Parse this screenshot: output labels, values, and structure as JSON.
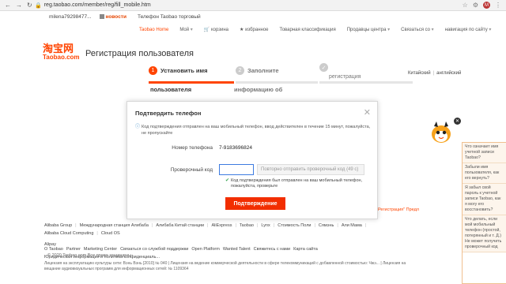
{
  "browser": {
    "url": "reg.taobao.com/member/reg/fill_mobile.htm",
    "profile_initial": "M"
  },
  "topbar": {
    "user": "milena79298477...",
    "news_label": "новости",
    "phone_line": "Телефон Taobao торговый"
  },
  "sitenav": {
    "items": [
      "Taobao Home",
      "Мой",
      "корзина",
      "избранное",
      "Товарная классификация",
      "Продавцы центра",
      "Связаться со",
      "навигация по сайту"
    ]
  },
  "header": {
    "logo_cn": "淘宝网",
    "logo_en": "Taobao.com",
    "title": "Регистрация пользователя"
  },
  "steps": {
    "step1_num": "1",
    "step1_label": "Установить имя",
    "step1_sub": "пользователя",
    "step2_num": "2",
    "step2_label": "Заполните",
    "step2_sub": "информацию об",
    "step3_label": "регистрация"
  },
  "lang": {
    "chinese": "Китайский",
    "english": "английский"
  },
  "modal": {
    "title": "Подтвердить телефон",
    "info": "Код подтверждения отправлен на ваш мобильный телефон, ввод действителен в течение 15 минут, пожалуйста, не пропускайте",
    "phone_label": "Номер телефона",
    "phone_value": "7-9183696824",
    "code_label": "Проверочный код",
    "code_value": "",
    "resend_label": "Повторно отправить проверочный код (49 с)",
    "ok_message": "Код подтверждения был отправлен на ваш мобильный телефон, пожалуйста, проверьте",
    "confirm_label": "Подтверждение"
  },
  "behind": {
    "agree_text": "Регистрация\" Предл"
  },
  "footer": {
    "links_row1": [
      "Alibaba Group",
      "Международная станция Алибаба",
      "Алибаба Китай станции",
      "AliExpress",
      "Taobao",
      "Lynx",
      "Стоимость Поли",
      "Сямэнь",
      "Али Мама",
      "Alibaba Cloud Computing",
      "Cloud OS",
      "Alipay"
    ],
    "links_row2": [
      "О Taobao",
      "Partner",
      "Marketing Center",
      "Связаться со службой поддержки",
      "Open Platform",
      "Wanted Talent",
      "Свяжитесь с нами",
      "Карта сайта",
      "Юридическая информация и политика конфиденциаль..."
    ],
    "copyright": "© 2020 Taobao.com Все права защищены",
    "license": "Лицензия на эксплуатацию культуры сети: Вэнь  Вэнь [2010] № 040  |  Лицензия на ведение коммерческой деятельности в сфере телекоммуникаций с добавленной стоимостью: Чжэ... | Лицензия на вещание аудиовизуальных программ для информационных сетей: № 1109364"
  },
  "help": {
    "items": [
      "Что означает имя учетной записи Taobao?",
      "Забыли имя пользователя, как его вернуть?",
      "Я забыл свой пароль к учетной записи Taobao, как я могу его восстановить?",
      "Что делать, если мой мобильный телефон (простой, потерянный и т. Д.) Не может получить проверочный код"
    ]
  }
}
